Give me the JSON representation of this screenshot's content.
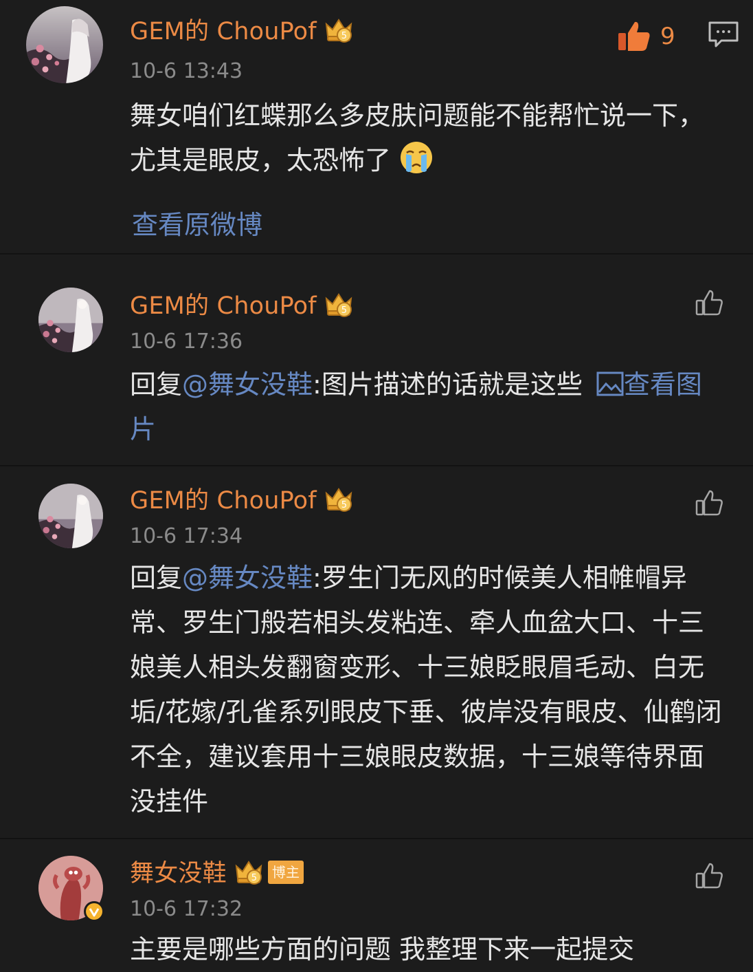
{
  "colors": {
    "background": "#1c1c1c",
    "username": "#ec8a45",
    "link": "#6688c2",
    "timestamp": "#8b8b8b",
    "text": "#e6e6e6",
    "badge": "#f0a640"
  },
  "main_comment": {
    "username": "GEM的 ChouPof",
    "member_badge": "crown-vip-icon",
    "member_level": "5",
    "timestamp": "10-6 13:43",
    "text": "舞女咱们红蝶那么多皮肤问题能不能帮忙说一下，尤其是眼皮，太恐怖了",
    "emoji": "crying-face-icon",
    "like_count": "9",
    "view_original_label": "查看原微博"
  },
  "replies": [
    {
      "username": "GEM的 ChouPof",
      "member_level": "5",
      "timestamp": "10-6 17:36",
      "reply_prefix": "回复",
      "mention": "@舞女没鞋",
      "text": ":图片描述的话就是这些 ",
      "link_label": "查看图片",
      "link_icon": "image-icon"
    },
    {
      "username": "GEM的 ChouPof",
      "member_level": "5",
      "timestamp": "10-6 17:34",
      "reply_prefix": "回复",
      "mention": "@舞女没鞋",
      "text": ":罗生门无风的时候美人相帷帽异常、罗生门般若相头发粘连、牵人血盆大口、十三娘美人相头发翻窗变形、十三娘眨眼眉毛动、白无垢/花嫁/孔雀系列眼皮下垂、彼岸没有眼皮、仙鹤闭不全，建议套用十三娘眼皮数据，十三娘等待界面没挂件"
    },
    {
      "username": "舞女没鞋",
      "member_level": "5",
      "host_badge": "博主",
      "verified_badge": "v-verified-icon",
      "timestamp": "10-6 17:32",
      "text": "主要是哪些方面的问题 我整理下来一起提交"
    }
  ]
}
